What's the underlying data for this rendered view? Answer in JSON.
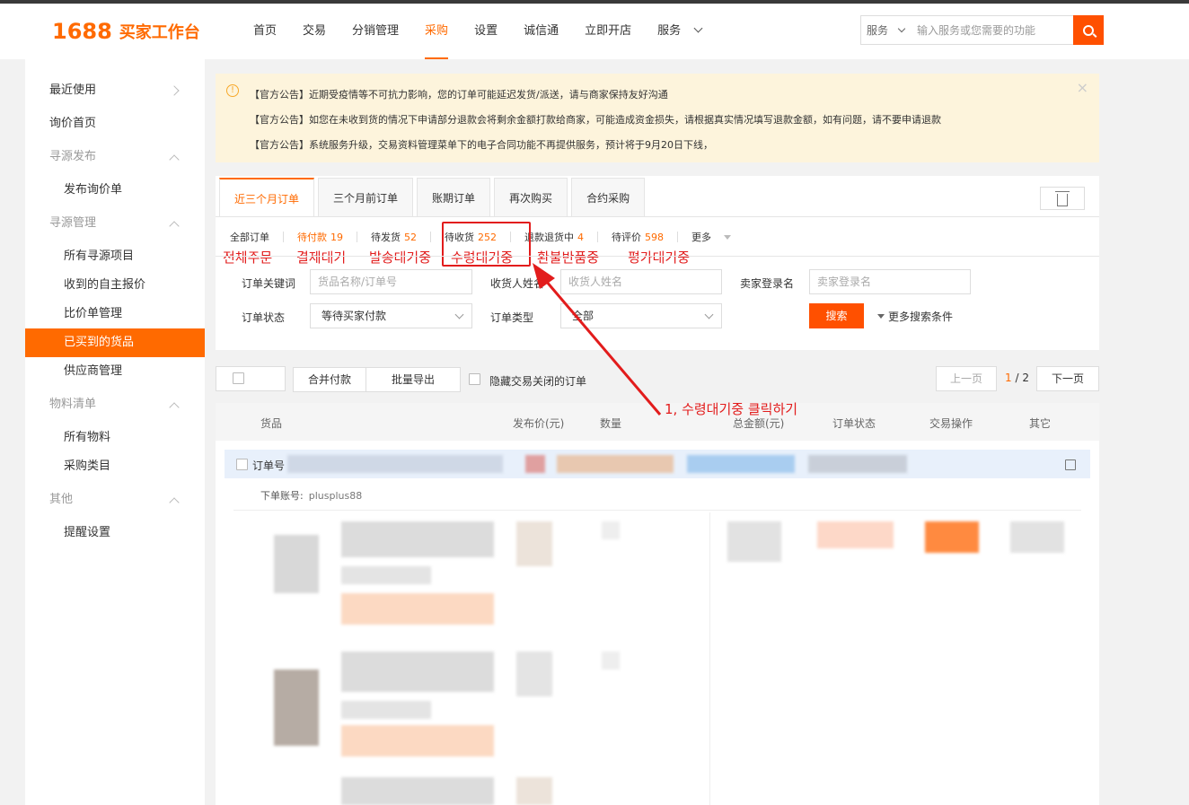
{
  "header": {
    "logo_num": "1688",
    "logo_text": "买家工作台",
    "nav": [
      {
        "label": "首页"
      },
      {
        "label": "交易"
      },
      {
        "label": "分销管理"
      },
      {
        "label": "采购"
      },
      {
        "label": "设置"
      },
      {
        "label": "诚信通"
      },
      {
        "label": "立即开店"
      },
      {
        "label": "服务"
      }
    ],
    "search_scope": "服务",
    "search_placeholder": "输入服务或您需要的功能"
  },
  "sidebar": {
    "items": [
      {
        "label": "最近使用"
      },
      {
        "label": "询价首页"
      },
      {
        "label": "寻源发布"
      },
      {
        "label": "发布询价单"
      },
      {
        "label": "寻源管理"
      },
      {
        "label": "所有寻源项目"
      },
      {
        "label": "收到的自主报价"
      },
      {
        "label": "比价单管理"
      },
      {
        "label": "已买到的货品"
      },
      {
        "label": "供应商管理"
      },
      {
        "label": "物料清单"
      },
      {
        "label": "所有物料"
      },
      {
        "label": "采购类目"
      },
      {
        "label": "其他"
      },
      {
        "label": "提醒设置"
      }
    ]
  },
  "notices": [
    "【官方公告】近期受疫情等不可抗力影响，您的订单可能延迟发货/派送，请与商家保持友好沟通",
    "【官方公告】如您在未收到货的情况下申请部分退款会将剩余金额打款给商家，可能造成资金损失，请根据真实情况填写退款金额，如有问题，请不要申请退款",
    "【官方公告】系统服务升级，交易资料管理菜单下的电子合同功能不再提供服务，预计将于9月20日下线，"
  ],
  "tabs": [
    {
      "label": "近三个月订单"
    },
    {
      "label": "三个月前订单"
    },
    {
      "label": "账期订单"
    },
    {
      "label": "再次购买"
    },
    {
      "label": "合约采购"
    }
  ],
  "statuses": [
    {
      "label": "全部订单",
      "count": ""
    },
    {
      "label": "待付款",
      "count": "19"
    },
    {
      "label": "待发货",
      "count": "52"
    },
    {
      "label": "待收货",
      "count": "252"
    },
    {
      "label": "退款退货中",
      "count": "4"
    },
    {
      "label": "待评价",
      "count": "598"
    },
    {
      "label": "更多",
      "count": ""
    }
  ],
  "annotations_ko": [
    "전체주문",
    "결제대기",
    "발송대기중",
    "수령대기중",
    "환불반품중",
    "평가대기중"
  ],
  "annotation_arrow_text": "1, 수령대기중 클릭하기",
  "filters": {
    "keyword_label": "订单关键词",
    "keyword_placeholder": "货品名称/订单号",
    "receiver_label": "收货人姓名",
    "receiver_placeholder": "收货人姓名",
    "seller_label": "卖家登录名",
    "seller_placeholder": "卖家登录名",
    "status_label": "订单状态",
    "status_value": "等待买家付款",
    "type_label": "订单类型",
    "type_value": "全部",
    "search_btn": "搜索",
    "more_conditions": "更多搜索条件"
  },
  "toolbar": {
    "merge_pay": "合并付款",
    "batch_export": "批量导出",
    "hide_closed": "隐藏交易关闭的订单",
    "prev": "上一页",
    "page_current": "1",
    "page_sep": "/",
    "page_total": "2",
    "next": "下一页"
  },
  "table_headers": [
    "货品",
    "发布价(元)",
    "数量",
    "总金额(元)",
    "订单状态",
    "交易操作",
    "其它"
  ],
  "order": {
    "head_label": "订单号",
    "account_label": "下单账号:",
    "account_value": "plusplus88"
  },
  "colors": {
    "brand": "#ff6a00",
    "annotation": "#e21c1c"
  }
}
